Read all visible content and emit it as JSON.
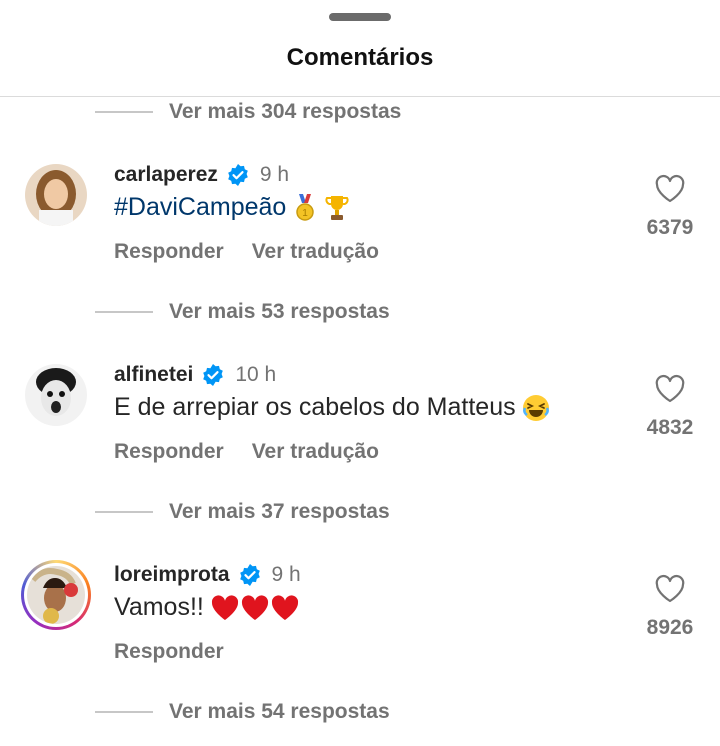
{
  "header": {
    "title": "Comentários"
  },
  "more_replies": [
    "Ver mais 304 respostas",
    "Ver mais 53 respostas",
    "Ver mais 37 respostas",
    "Ver mais 54 respostas"
  ],
  "comments": [
    {
      "username": "carlaperez",
      "time": "9 h",
      "text": "#DaviCampeão",
      "reply_label": "Responder",
      "translate_label": "Ver tradução",
      "likes": "6379",
      "emojis": [
        "medal",
        "trophy"
      ]
    },
    {
      "username": "alfinetei",
      "time": "10 h",
      "text": "E de arrepiar os cabelos do Matteus",
      "reply_label": "Responder",
      "translate_label": "Ver tradução",
      "likes": "4832",
      "emojis": [
        "laughing-face"
      ]
    },
    {
      "username": "loreimprota",
      "time": "9 h",
      "text": "Vamos!!",
      "reply_label": "Responder",
      "likes": "8926",
      "emojis": [
        "red-heart",
        "red-heart",
        "red-heart"
      ]
    }
  ],
  "colors": {
    "verified": "#0095f6",
    "hashtag": "#00376b",
    "muted": "#737373"
  }
}
